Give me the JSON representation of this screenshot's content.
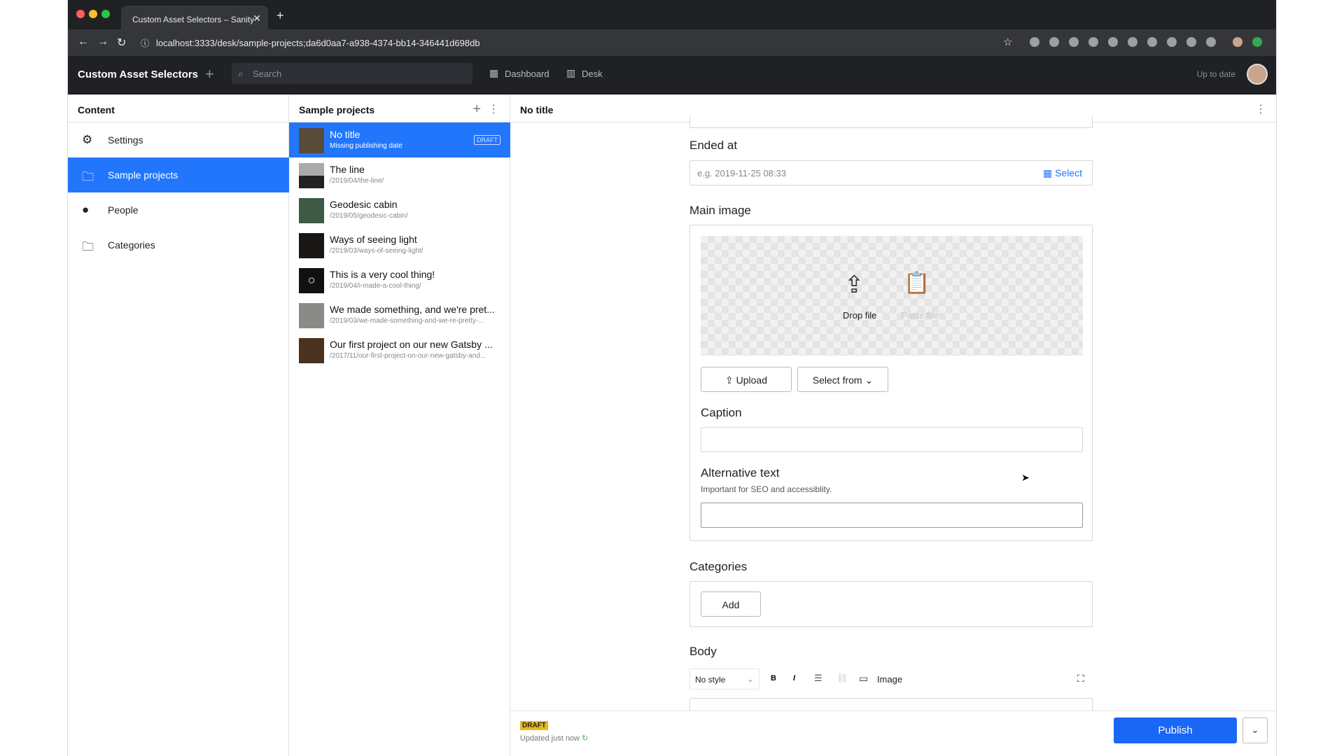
{
  "browser": {
    "tab_title": "Custom Asset Selectors – Sanity",
    "url": "localhost:3333/desk/sample-projects;da6d0aa7-a938-4374-bb14-346441d698db"
  },
  "header": {
    "brand": "Custom Asset Selectors",
    "search_placeholder": "Search",
    "tools": [
      "Dashboard",
      "Desk"
    ],
    "status": "Up to date"
  },
  "content_pane": {
    "title": "Content",
    "items": [
      {
        "label": "Settings",
        "icon": "gear-icon"
      },
      {
        "label": "Sample projects",
        "icon": "folder-icon"
      },
      {
        "label": "People",
        "icon": "person-icon"
      },
      {
        "label": "Categories",
        "icon": "folder-icon"
      }
    ]
  },
  "projects_pane": {
    "title": "Sample projects",
    "items": [
      {
        "title": "No title",
        "subtitle": "Missing publishing date",
        "badge": "DRAFT"
      },
      {
        "title": "The line",
        "subtitle": "/2019/04/the-line/"
      },
      {
        "title": "Geodesic cabin",
        "subtitle": "/2019/05/geodesic-cabin/"
      },
      {
        "title": "Ways of seeing light",
        "subtitle": "/2019/03/ways-of-seeing-light/"
      },
      {
        "title": "This is a very cool thing!",
        "subtitle": "/2019/04/i-made-a-cool-thing/"
      },
      {
        "title": "We made something, and we're pret...",
        "subtitle": "/2019/03/we-made-something-and-we-re-pretty-..."
      },
      {
        "title": "Our first project on our new Gatsby ...",
        "subtitle": "/2017/11/our-first-project-on-our-new-gatsby-and..."
      }
    ]
  },
  "editor": {
    "title": "No title",
    "ended_at_label": "Ended at",
    "ended_at_placeholder": "e.g. 2019-11-25 08:33",
    "select_label": "Select",
    "main_image_label": "Main image",
    "drop_file": "Drop file",
    "paste_file": "Paste file",
    "upload": "Upload",
    "select_from": "Select from",
    "caption_label": "Caption",
    "alt_label": "Alternative text",
    "alt_description": "Important for SEO and accessiblity.",
    "categories_label": "Categories",
    "add": "Add",
    "body_label": "Body",
    "style_select": "No style",
    "image_button": "Image"
  },
  "footer": {
    "draft_tag": "DRAFT",
    "updated": "Updated just now",
    "publish": "Publish"
  },
  "colors": {
    "accent": "#2276fc",
    "publish": "#1a66f5",
    "draft": "#e8b918"
  }
}
